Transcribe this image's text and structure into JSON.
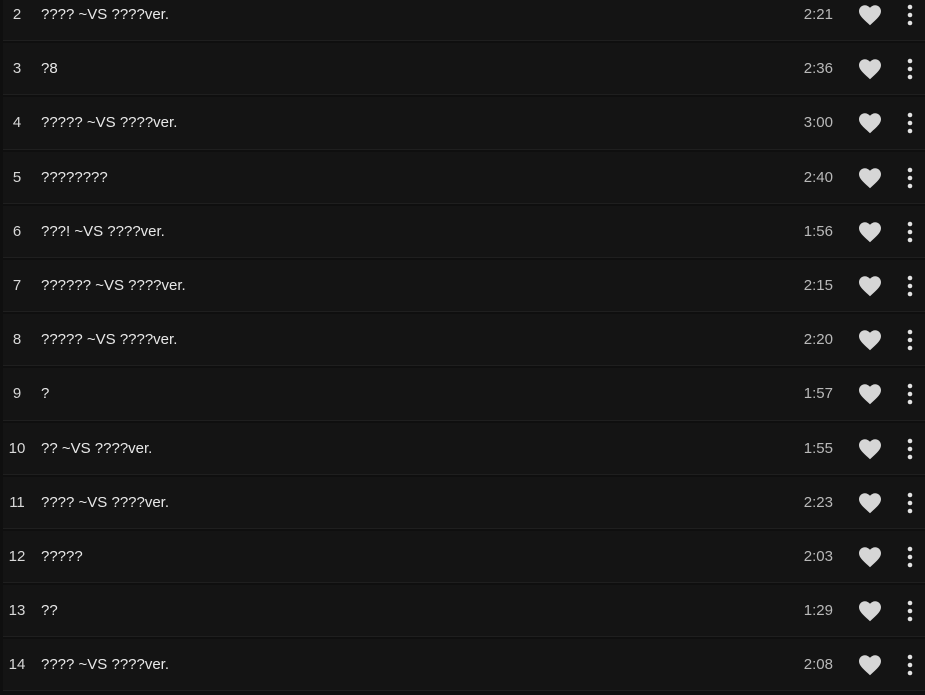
{
  "tracklist": {
    "tracks": [
      {
        "number": "2",
        "title": "???? ~VS ????ver.",
        "duration": "2:21"
      },
      {
        "number": "3",
        "title": "?8",
        "duration": "2:36"
      },
      {
        "number": "4",
        "title": "????? ~VS ????ver.",
        "duration": "3:00"
      },
      {
        "number": "5",
        "title": "????????",
        "duration": "2:40"
      },
      {
        "number": "6",
        "title": "???! ~VS ????ver.",
        "duration": "1:56"
      },
      {
        "number": "7",
        "title": "?????? ~VS ????ver.",
        "duration": "2:15"
      },
      {
        "number": "8",
        "title": "????? ~VS ????ver.",
        "duration": "2:20"
      },
      {
        "number": "9",
        "title": "?",
        "duration": "1:57"
      },
      {
        "number": "10",
        "title": "?? ~VS ????ver.",
        "duration": "1:55"
      },
      {
        "number": "11",
        "title": "???? ~VS ????ver.",
        "duration": "2:23"
      },
      {
        "number": "12",
        "title": "?????",
        "duration": "2:03"
      },
      {
        "number": "13",
        "title": "??",
        "duration": "1:29"
      },
      {
        "number": "14",
        "title": "???? ~VS ????ver.",
        "duration": "2:08"
      }
    ],
    "icons": {
      "like": "heart-icon",
      "more": "more-vertical-icon"
    },
    "colors": {
      "background": "#0f0f0f",
      "row": "#141414",
      "text": "#e8e8e8",
      "duration": "#b9b9b9",
      "icon": "#d6d6d6"
    }
  }
}
